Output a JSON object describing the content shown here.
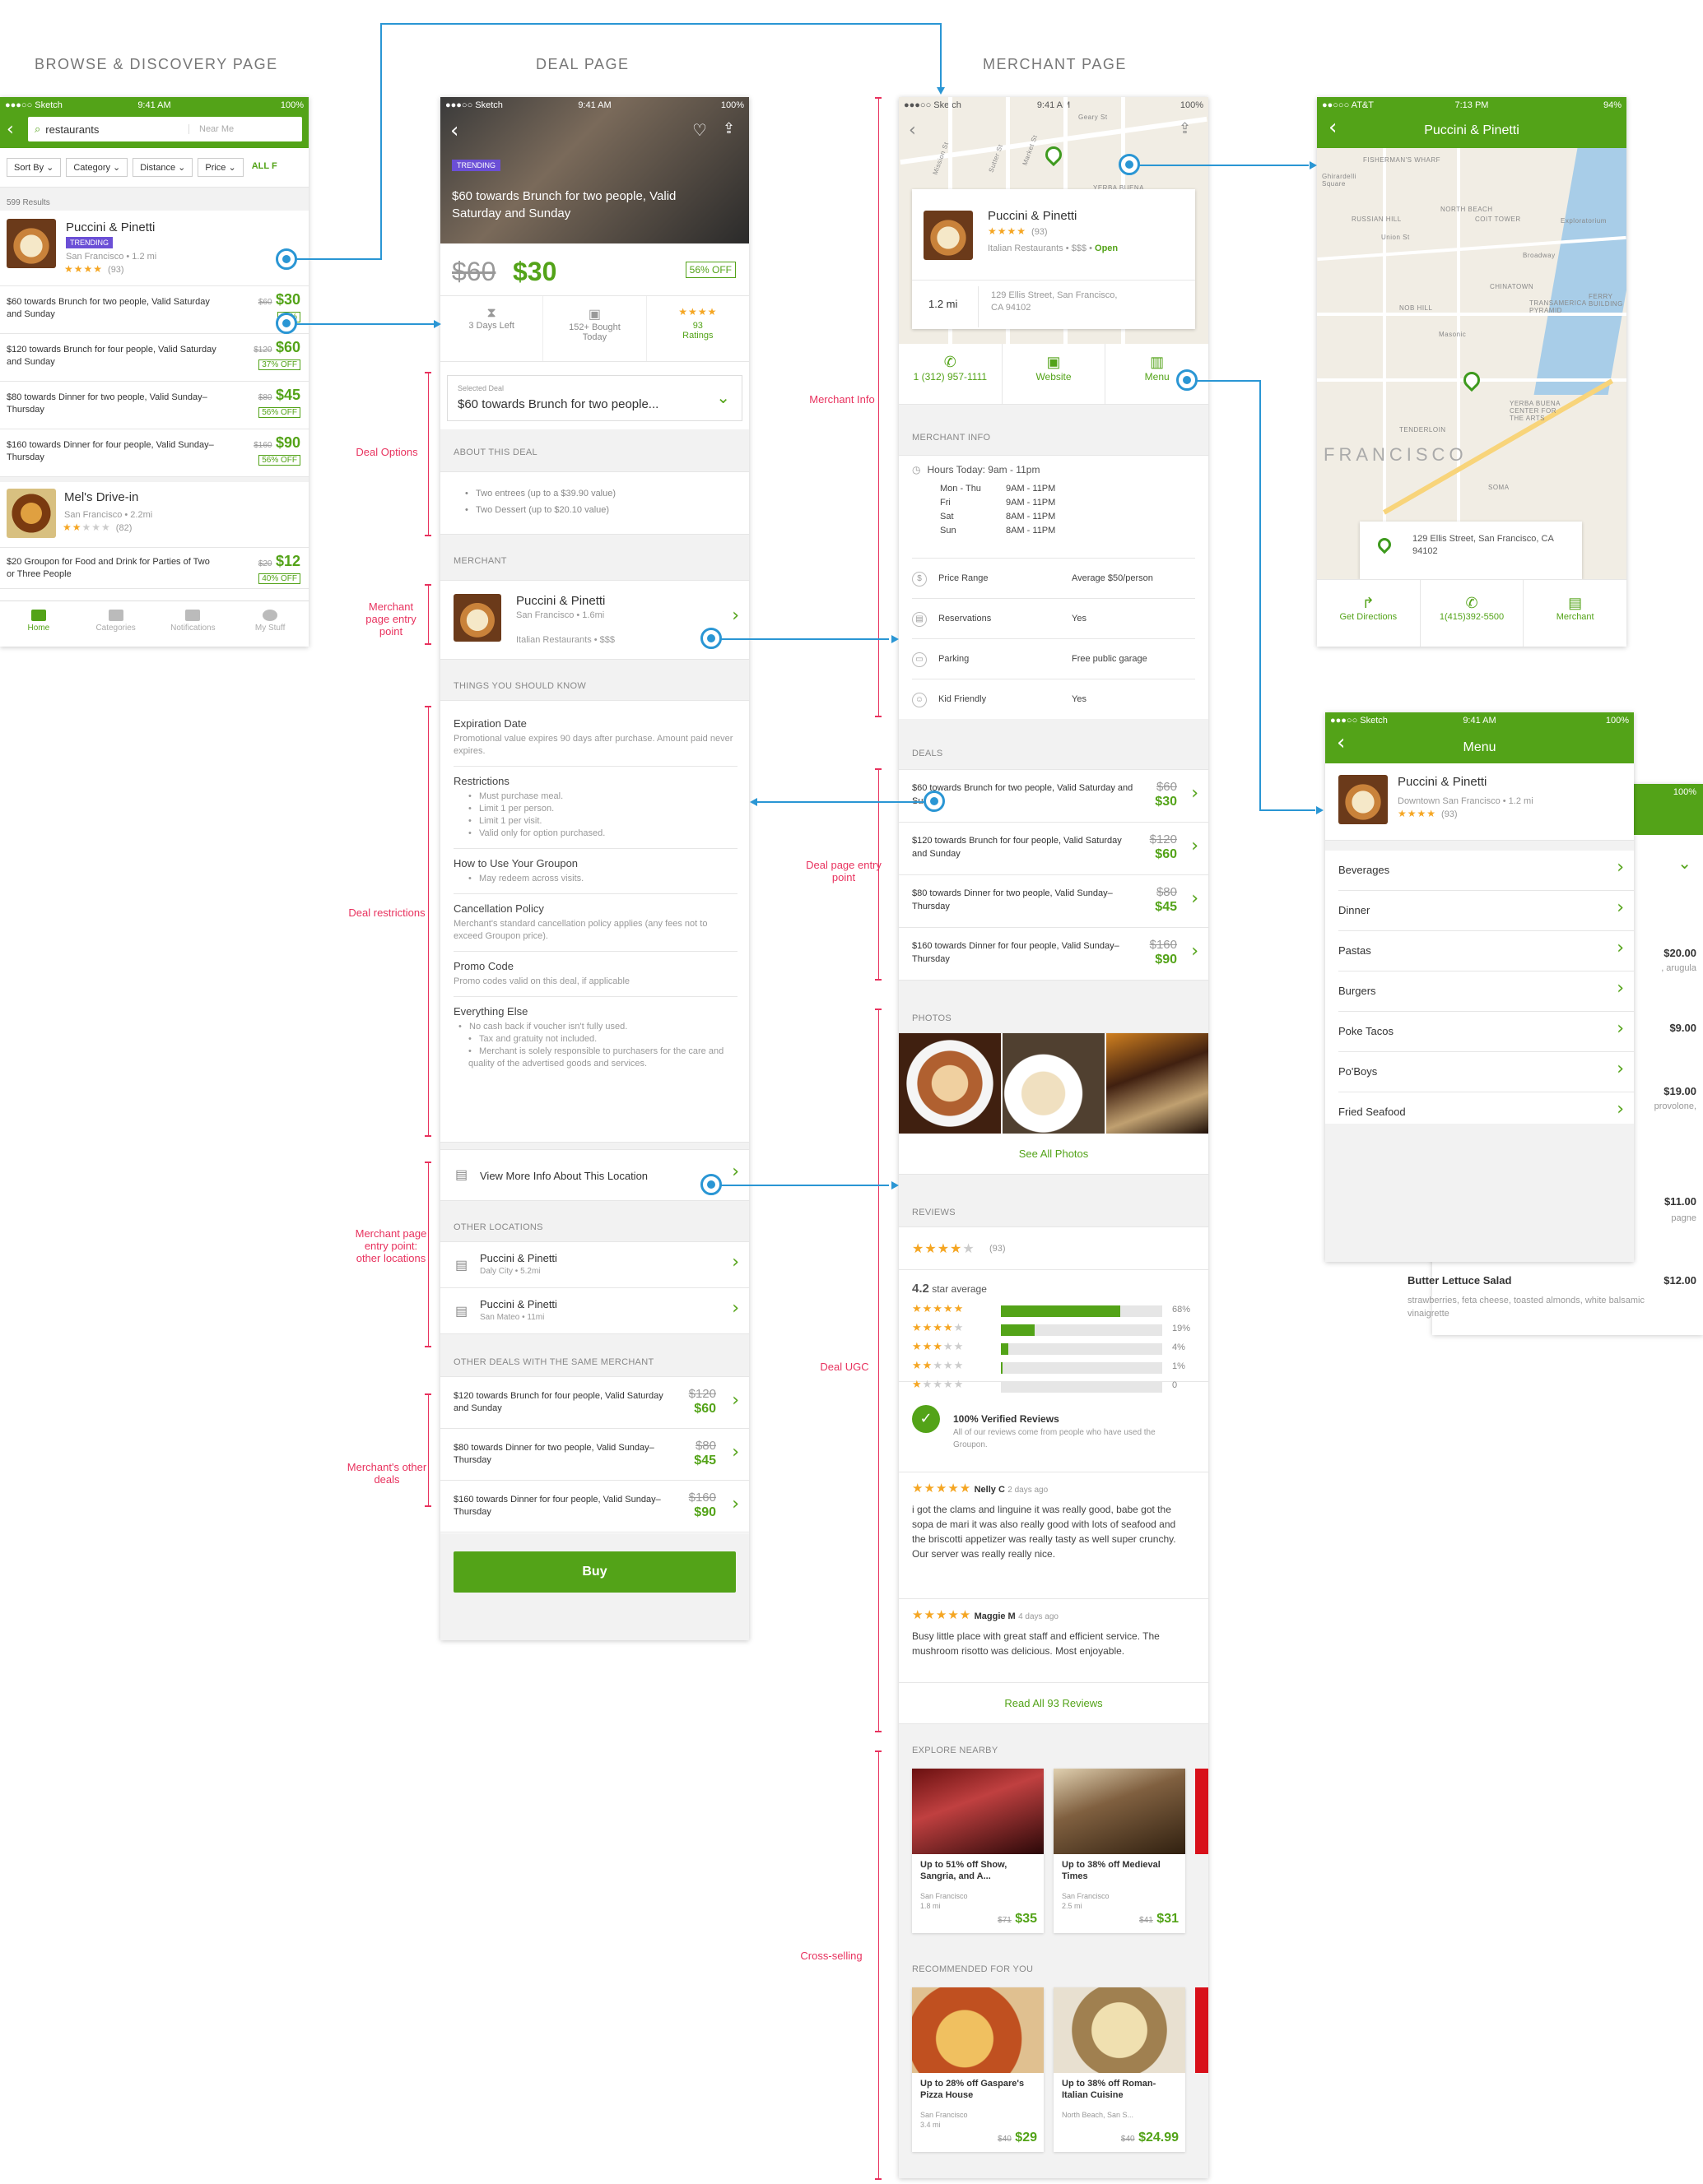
{
  "sections": {
    "browse": "BROWSE & DISCOVERY PAGE",
    "deal": "DEAL PAGE",
    "merchant": "MERCHANT PAGE"
  },
  "colors": {
    "brand": "#53a318",
    "annotation": "#e8325e",
    "connector": "#2a96d4",
    "trending": "#6b4fd6"
  },
  "status": {
    "carrier": "●●●○○ Sketch",
    "time": "9:41 AM",
    "battery": "100%",
    "att_carrier": "●●○○○ AT&T",
    "att_time": "7:13 PM",
    "att_battery": "94%"
  },
  "browse": {
    "search_value": "restaurants",
    "near_me": "Near Me",
    "filters": [
      "Sort By",
      "Category",
      "Distance",
      "Price",
      "ALL F"
    ],
    "results": "599 Results",
    "m1": {
      "name": "Puccini & Pinetti",
      "badge": "TRENDING",
      "loc": "San Francisco • 1.2 mi",
      "stars": "★★★★",
      "count": "(93)"
    },
    "deals": [
      {
        "title": "$60 towards Brunch for two people, Valid Saturday and Sunday",
        "old": "$60",
        "new": "$30",
        "off": "50%"
      },
      {
        "title": "$120 towards Brunch for four people, Valid Saturday and Sunday",
        "old": "$120",
        "new": "$60",
        "off": "37% OFF"
      },
      {
        "title": "$80 towards Dinner for two people, Valid Sunday–Thursday",
        "old": "$80",
        "new": "$45",
        "off": "56% OFF"
      },
      {
        "title": "$160 towards Dinner for four people, Valid Sunday–Thursday",
        "old": "$160",
        "new": "$90",
        "off": "56% OFF"
      }
    ],
    "m2": {
      "name": "Mel's Drive-in",
      "loc": "San Francisco • 2.2mi",
      "stars": "★★",
      "count": "(82)"
    },
    "deal5": {
      "title": "$20 Groupon for Food and Drink for Parties of Two or Three People",
      "old": "$20",
      "new": "$12",
      "off": "40% OFF"
    },
    "tabs": [
      "Home",
      "Categories",
      "Notifications",
      "My Stuff"
    ]
  },
  "deal": {
    "badge": "TRENDING",
    "hero_title": "$60 towards Brunch for two people, Valid Saturday and Sunday",
    "old": "$60",
    "new": "$30",
    "off": "56% OFF",
    "stat1": "3 Days Left",
    "stat2": "152+ Bought Today",
    "stat3_stars": "★★★★",
    "stat3": "93 Ratings",
    "sel_label": "Selected Deal",
    "sel_value": "$60 towards Brunch for two people...",
    "about_hdr": "ABOUT THIS DEAL",
    "about": [
      "Two entrees (up to a $39.90 value)",
      "Two Dessert (up to $20.10 value)"
    ],
    "merchant_hdr": "MERCHANT",
    "merchant": {
      "name": "Puccini & Pinetti",
      "loc": "San Francisco • 1.6mi",
      "cat": "Italian Restaurants • $$$"
    },
    "things_hdr": "THINGS YOU SHOULD KNOW",
    "exp_t": "Expiration Date",
    "exp_d": "Promotional value expires 90 days after purchase. Amount paid never expires.",
    "res_t": "Restrictions",
    "res": [
      "Must purchase meal.",
      "Limit 1 per person.",
      "Limit 1 per visit.",
      "Valid only for option purchased."
    ],
    "how_t": "How to Use Your Groupon",
    "how": [
      "May redeem across visits."
    ],
    "can_t": "Cancellation Policy",
    "can_d": "Merchant's standard cancellation policy applies (any fees not to exceed Groupon price).",
    "promo_t": "Promo Code",
    "promo_d": "Promo codes valid on this deal, if applicable",
    "else_t": "Everything Else",
    "else": [
      "No cash back if voucher isn't fully used.",
      "Tax and gratuity not included.",
      "Merchant is solely responsible to purchasers for the care and quality of the advertised goods and services."
    ],
    "viewmore": "View More Info About This Location",
    "other_hdr": "OTHER LOCATIONS",
    "locs": [
      {
        "name": "Puccini & Pinetti",
        "sub": "Daly City • 5.2mi"
      },
      {
        "name": "Puccini & Pinetti",
        "sub": "San Mateo • 11mi"
      }
    ],
    "same_hdr": "OTHER DEALS WITH THE SAME MERCHANT",
    "same": [
      {
        "title": "$120 towards Brunch for four people, Valid Saturday and Sunday",
        "old": "$120",
        "new": "$60"
      },
      {
        "title": "$80 towards Dinner for two people, Valid Sunday–Thursday",
        "old": "$80",
        "new": "$45"
      },
      {
        "title": "$160 towards Dinner for four people, Valid Sunday–Thursday",
        "old": "$160",
        "new": "$90"
      }
    ],
    "buy": "Buy"
  },
  "notes": {
    "deal_options": "Deal Options",
    "merchant_entry": "Merchant page entry point",
    "deal_restrictions": "Deal restrictions",
    "merchant_other_loc": "Merchant page entry point: other locations",
    "merchant_other_deals": "Merchant's other deals",
    "merchant_info": "Merchant Info",
    "deal_entry": "Deal page entry point",
    "deal_ugc": "Deal UGC",
    "cross": "Cross-selling"
  },
  "merchant": {
    "map_labels": [
      "Mission St",
      "Market St",
      "Geary St",
      "Sutter St",
      "YERBA BUENA"
    ],
    "name": "Puccini & Pinetti",
    "stars": "★★★★",
    "count": "(93)",
    "cat": "Italian Restaurants • $$$ •",
    "open": "Open",
    "dist": "1.2 mi",
    "addr": "129 Ellis Street, San Francisco, CA 94102",
    "actions": [
      "1 (312) 957-1111",
      "Website",
      "Menu"
    ],
    "info_hdr": "MERCHANT INFO",
    "hours_t": "Hours Today: 9am - 11pm",
    "hours": [
      [
        "Mon - Thu",
        "9AM - 11PM"
      ],
      [
        "Fri",
        "9AM - 11PM"
      ],
      [
        "Sat",
        "8AM - 11PM"
      ],
      [
        "Sun",
        "8AM - 11PM"
      ]
    ],
    "info": [
      [
        "Price Range",
        "Average $50/person"
      ],
      [
        "Reservations",
        "Yes"
      ],
      [
        "Parking",
        "Free public garage"
      ],
      [
        "Kid Friendly",
        "Yes"
      ]
    ],
    "deals_hdr": "DEALS",
    "deals": [
      {
        "title": "$60 towards Brunch for two people, Valid Saturday and Sunday",
        "old": "$60",
        "new": "$30"
      },
      {
        "title": "$120 towards Brunch for four people, Valid Saturday and Sunday",
        "old": "$120",
        "new": "$60"
      },
      {
        "title": "$80 towards Dinner for two people, Valid Sunday–Thursday",
        "old": "$80",
        "new": "$45"
      },
      {
        "title": "$160 towards Dinner for four people, Valid Sunday–Thursday",
        "old": "$160",
        "new": "$90"
      }
    ],
    "photos_hdr": "PHOTOS",
    "see_all": "See All Photos",
    "reviews_hdr": "REVIEWS",
    "rev_stars": "★★★★",
    "rev_count": "(93)",
    "avg": "4.2",
    "avg_t": "star average",
    "bars": [
      {
        "p": 68,
        "l": "68%"
      },
      {
        "p": 19,
        "l": "19%"
      },
      {
        "p": 4,
        "l": "4%"
      },
      {
        "p": 1,
        "l": "1%"
      },
      {
        "p": 0,
        "l": "0"
      }
    ],
    "verified_t": "100% Verified Reviews",
    "verified_d": "All of our reviews come from people who have used the Groupon.",
    "r1_name": "Nelly C",
    "r1_when": "2 days ago",
    "r1_text": "i got the clams and linguine it was really good, babe got the sopa de mari it was also really good with lots of seafood and the briscotti appetizer was really tasty as well super crunchy. Our server was really really nice.",
    "r2_name": "Maggie M",
    "r2_when": "4 days ago",
    "r2_text": "Busy little place with great staff and efficient service. The mushroom risotto was delicious. Most enjoyable.",
    "read_all": "Read All 93 Reviews",
    "explore_hdr": "EXPLORE NEARBY",
    "explore": [
      {
        "t": "Up to 51% off Show, Sangria, and A...",
        "s": "San Francisco",
        "d": "1.8 mi",
        "old": "$71",
        "new": "$35"
      },
      {
        "t": "Up to 38% off Medieval Times",
        "s": "San Francisco",
        "d": "2.5 mi",
        "old": "$41",
        "new": "$31"
      }
    ],
    "rec_hdr": "RECOMMENDED FOR YOU",
    "rec": [
      {
        "t": "Up to 28% off Gaspare's Pizza House",
        "s": "San Francisco",
        "d": "3.4 mi",
        "old": "$40",
        "new": "$29"
      },
      {
        "t": "Up to 38% off Roman-Italian Cuisine",
        "s": "North Beach, San S...",
        "d": "",
        "old": "$40",
        "new": "$24.99"
      }
    ]
  },
  "mapscreen": {
    "title": "Puccini & Pinetti",
    "addr": "129 Ellis Street, San Francisco, CA 94102",
    "city": "FRANCISCO",
    "actions": [
      "Get Directions",
      "1(415)392-5500",
      "Merchant"
    ],
    "labels": [
      "FISHERMAN'S WHARF",
      "RUSSIAN HILL",
      "NORTH BEACH",
      "COIT TOWER",
      "Broadway",
      "CHINATOWN",
      "NOB HILL",
      "TRANSAMERICA PYRAMID",
      "FERRY BUILDING",
      "TENDERLOIN",
      "YERBA BUENA CENTER FOR THE ARTS",
      "SOMA",
      "Exploratorium",
      "Ghirardelli Square",
      "Union St",
      "Masonic"
    ]
  },
  "menu": {
    "title": "Menu",
    "name": "Puccini & Pinetti",
    "loc": "Downtown San Francisco • 1.2 mi",
    "stars": "★★★★",
    "count": "(93)",
    "items": [
      "Beverages",
      "Dinner",
      "Pastas",
      "Burgers",
      "Poke Tacos",
      "Po'Boys",
      "Fried Seafood"
    ],
    "behind_prices": [
      "$20.00",
      "$9.00",
      "$19.00",
      "$11.00",
      "$12.00"
    ],
    "behind_frags": [
      ", arugula",
      "provolone,",
      "pagne"
    ],
    "behind_title": "Butter Lettuce Salad",
    "behind_desc": "strawberries, feta cheese, toasted almonds, white balsamic vinaigrette",
    "behind_battery": "100%"
  }
}
